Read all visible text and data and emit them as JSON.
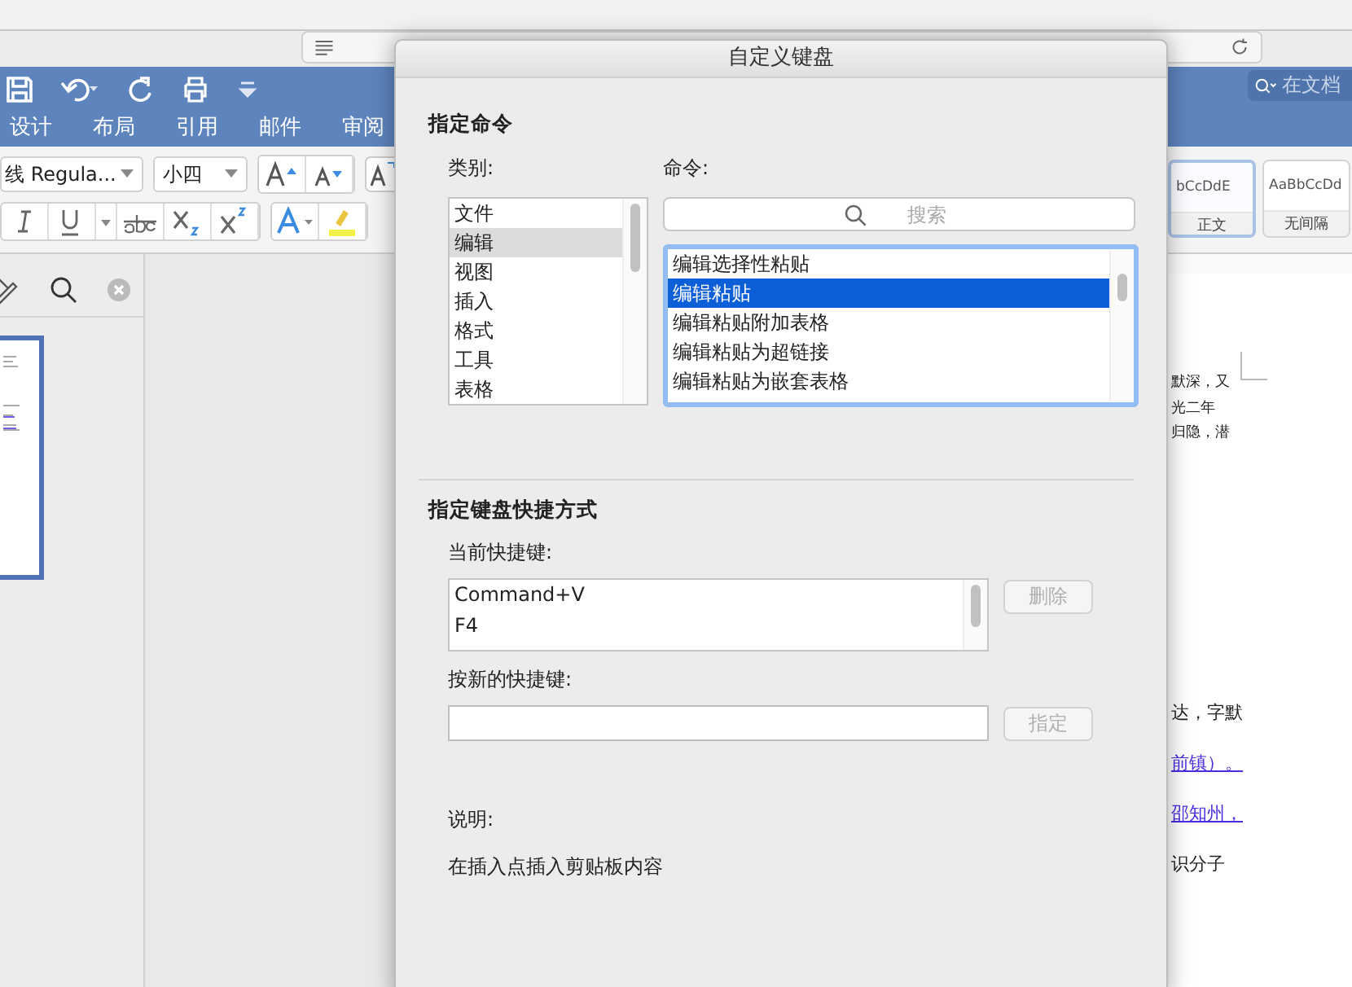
{
  "ribbon": {
    "tabs": [
      {
        "label": "设计"
      },
      {
        "label": "布局"
      },
      {
        "label": "引用"
      },
      {
        "label": "邮件"
      },
      {
        "label": "审阅"
      }
    ],
    "search": {
      "placeholder": "在文档"
    }
  },
  "toolbar": {
    "font": "线 Regula...",
    "size": "小四",
    "styles": [
      {
        "sample": "bCcDdE",
        "name": "正文",
        "selected": true
      },
      {
        "sample": "AaBbCcDd",
        "name": "无间隔",
        "selected": false
      }
    ]
  },
  "document": {
    "lines": [
      {
        "text": "默深，又",
        "link": false
      },
      {
        "text": "光二年",
        "link": false
      },
      {
        "text": "归隐，潜",
        "link": false
      },
      {
        "text": "达，字默",
        "link": false
      },
      {
        "text": "前镇）。",
        "link": true
      },
      {
        "text": "邵知州，",
        "link": true
      },
      {
        "text": "识分子",
        "link": false
      }
    ]
  },
  "dialog": {
    "title": "自定义键盘",
    "section_command": "指定命令",
    "category_label": "类别:",
    "categories": [
      {
        "label": "文件",
        "selected": false
      },
      {
        "label": "编辑",
        "selected": true
      },
      {
        "label": "视图",
        "selected": false
      },
      {
        "label": "插入",
        "selected": false
      },
      {
        "label": "格式",
        "selected": false
      },
      {
        "label": "工具",
        "selected": false
      },
      {
        "label": "表格",
        "selected": false
      }
    ],
    "command_label": "命令:",
    "search_placeholder": "搜索",
    "commands": [
      {
        "label": "编辑选择性粘贴",
        "selected": false
      },
      {
        "label": "编辑粘贴",
        "selected": true
      },
      {
        "label": "编辑粘贴附加表格",
        "selected": false
      },
      {
        "label": "编辑粘贴为超链接",
        "selected": false
      },
      {
        "label": "编辑粘贴为嵌套表格",
        "selected": false
      }
    ],
    "section_shortcut": "指定键盘快捷方式",
    "current_label": "当前快捷键:",
    "current_keys": [
      "Command+V",
      "F4"
    ],
    "remove_button": {
      "label": "删除",
      "disabled": true
    },
    "new_label": "按新的快捷键:",
    "assign_button": {
      "label": "指定",
      "disabled": true
    },
    "description_label": "说明:",
    "description": "在插入点插入剪贴板内容"
  }
}
